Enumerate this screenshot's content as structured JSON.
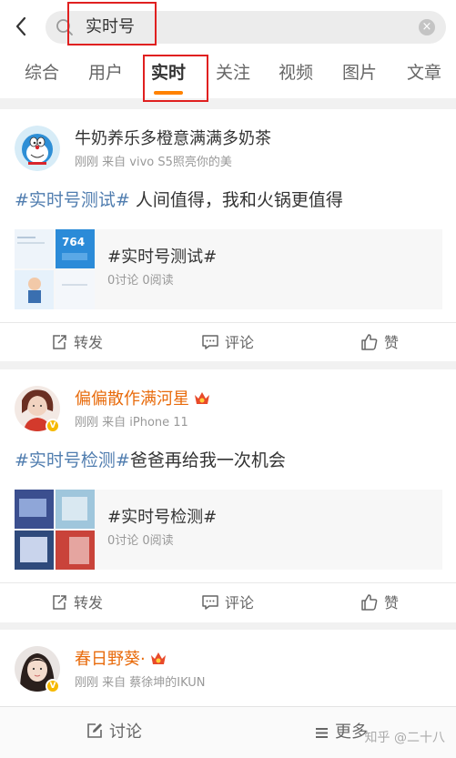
{
  "search": {
    "query": "实时号"
  },
  "tabs": [
    {
      "label": "综合"
    },
    {
      "label": "用户"
    },
    {
      "label": "实时"
    },
    {
      "label": "关注"
    },
    {
      "label": "视频"
    },
    {
      "label": "图片"
    },
    {
      "label": "文章"
    }
  ],
  "active_tab": "实时",
  "posts": [
    {
      "username": "牛奶养乐多橙意满满多奶茶",
      "meta": "刚刚 来自 vivo S5照亮你的美",
      "hashtag": "#实时号测试#",
      "text": " 人间值得，我和火锅更值得",
      "card_title": "#实时号测试#",
      "card_sub": "0讨论 0阅读",
      "thumb_number": "764"
    },
    {
      "username": "偏偏散作满河星",
      "meta": "刚刚 来自 iPhone 11",
      "hashtag": "#实时号检测#",
      "text": "爸爸再给我一次机会",
      "card_title": "#实时号检测#",
      "card_sub": "0讨论 0阅读"
    },
    {
      "username": "春日野葵·",
      "meta": "刚刚 来自 蔡徐坤的IKUN"
    }
  ],
  "actions": {
    "repost": "转发",
    "comment": "评论",
    "like": "赞"
  },
  "bottom": {
    "discuss": "讨论",
    "more": "更多"
  },
  "watermark": "知乎 @二十八",
  "colors": {
    "accent": "#ff8200",
    "hashtag": "#507daf",
    "username_vip": "#e86b0c",
    "highlight_box": "#e02020"
  }
}
